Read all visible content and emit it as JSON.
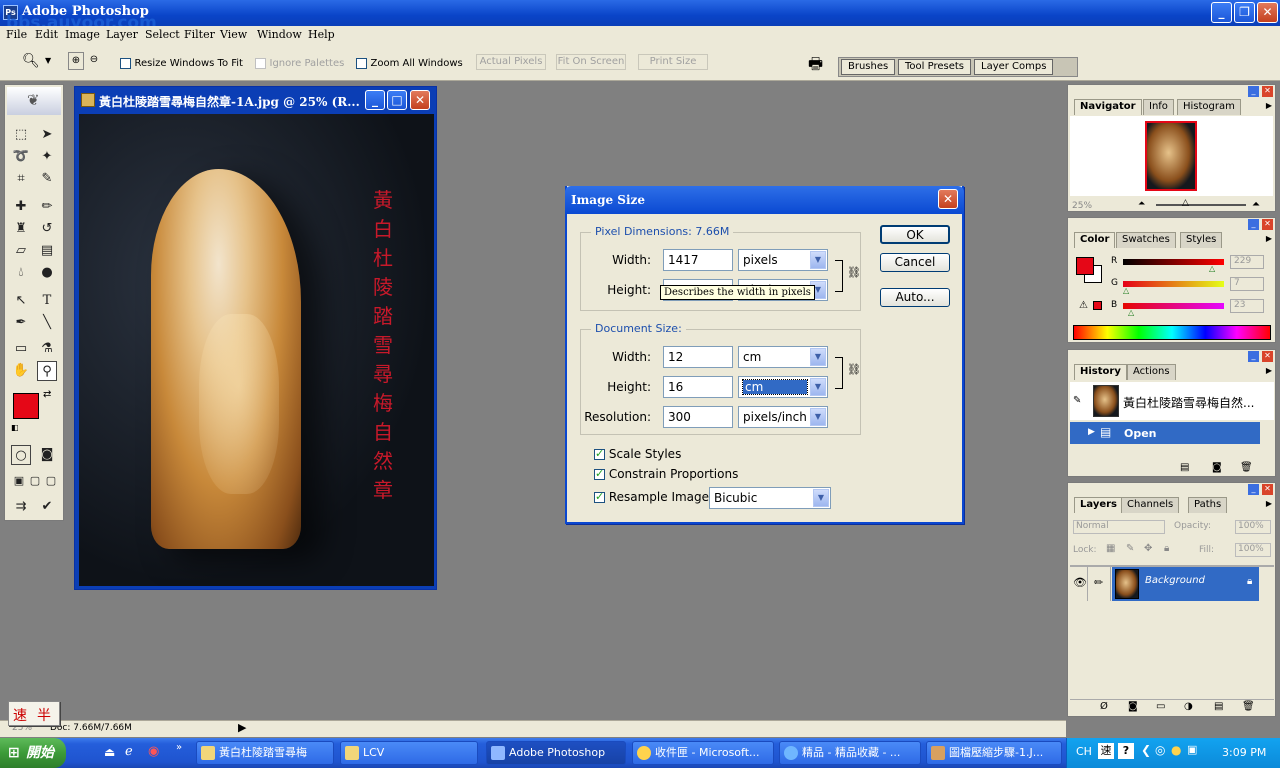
{
  "app": {
    "title": "Adobe Photoshop",
    "watermark": "bbs.auvoor.com"
  },
  "menu": [
    "File",
    "Edit",
    "Image",
    "Layer",
    "Select",
    "Filter",
    "View",
    "Window",
    "Help"
  ],
  "options": {
    "resize_windows": "Resize Windows To Fit",
    "ignore_palettes": "Ignore Palettes",
    "zoom_all": "Zoom All Windows",
    "actual_pixels": "Actual Pixels",
    "fit_on_screen": "Fit On Screen",
    "print_size": "Print Size",
    "well_tabs": [
      "Brushes",
      "Tool Presets",
      "Layer Comps"
    ]
  },
  "document": {
    "title": "黃白杜陵踏雪尋梅自然章-1A.jpg @ 25% (R...",
    "vertical_text": "黃白杜陵踏雪尋梅自然章",
    "status": "Doc: 7.66M/7.66M",
    "zoom": "25%"
  },
  "dialog": {
    "title": "Image Size",
    "pixel_dims_label": "Pixel Dimensions:",
    "pixel_dims_value": "7.66M",
    "width_label": "Width:",
    "height_label": "Height:",
    "px_width": "1417",
    "px_width_unit": "pixels",
    "px_height_unit": "pixels",
    "tooltip": "Describes the width in pixels",
    "doc_size_label": "Document Size:",
    "doc_width": "12",
    "doc_width_unit": "cm",
    "doc_height": "16",
    "doc_height_unit": "cm",
    "resolution_label": "Resolution:",
    "resolution": "300",
    "resolution_unit": "pixels/inch",
    "scale_styles": "Scale Styles",
    "constrain": "Constrain Proportions",
    "resample": "Resample Image:",
    "resample_method": "Bicubic",
    "ok": "OK",
    "cancel": "Cancel",
    "auto": "Auto..."
  },
  "navigator": {
    "tabs": [
      "Navigator",
      "Info",
      "Histogram"
    ],
    "zoom": "25%"
  },
  "color": {
    "tabs": [
      "Color",
      "Swatches",
      "Styles"
    ],
    "r_label": "R",
    "g_label": "G",
    "b_label": "B",
    "r": "229",
    "g": "7",
    "b": "23",
    "fg_color": "#e50717"
  },
  "history": {
    "tabs": [
      "History",
      "Actions"
    ],
    "snapshot": "黃白杜陵踏雪尋梅自然...",
    "step": "Open"
  },
  "layers": {
    "tabs": [
      "Layers",
      "Channels",
      "Paths"
    ],
    "blend": "Normal",
    "opacity_label": "Opacity:",
    "opacity": "100%",
    "lock_label": "Lock:",
    "fill_label": "Fill:",
    "fill": "100%",
    "layer_name": "Background"
  },
  "ime": [
    "速",
    "半"
  ],
  "taskbar": {
    "start": "開始",
    "tasks": [
      "黃白杜陵踏雪尋梅",
      "LCV",
      "Adobe Photoshop",
      "收件匣 - Microsoft...",
      "精品 - 精品收藏 - ...",
      "圖檔壓縮步驟-1.J..."
    ],
    "lang": "CH",
    "time": "3:09 PM"
  }
}
